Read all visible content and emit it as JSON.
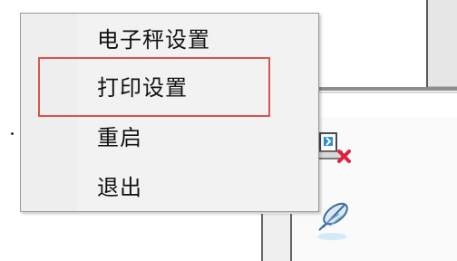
{
  "menu": {
    "items": [
      {
        "label": "电子秤设置"
      },
      {
        "label": "打印设置"
      },
      {
        "label": "重启"
      },
      {
        "label": "退出"
      }
    ],
    "highlighted_index": 1
  },
  "colors": {
    "menu_background": "#f2f2f2",
    "highlight_border": "#d9534f",
    "icon_red_x": "#e2213f",
    "icon_blue": "#2f8fd6"
  },
  "icons": [
    "printer-error-icon",
    "feather-icon"
  ]
}
